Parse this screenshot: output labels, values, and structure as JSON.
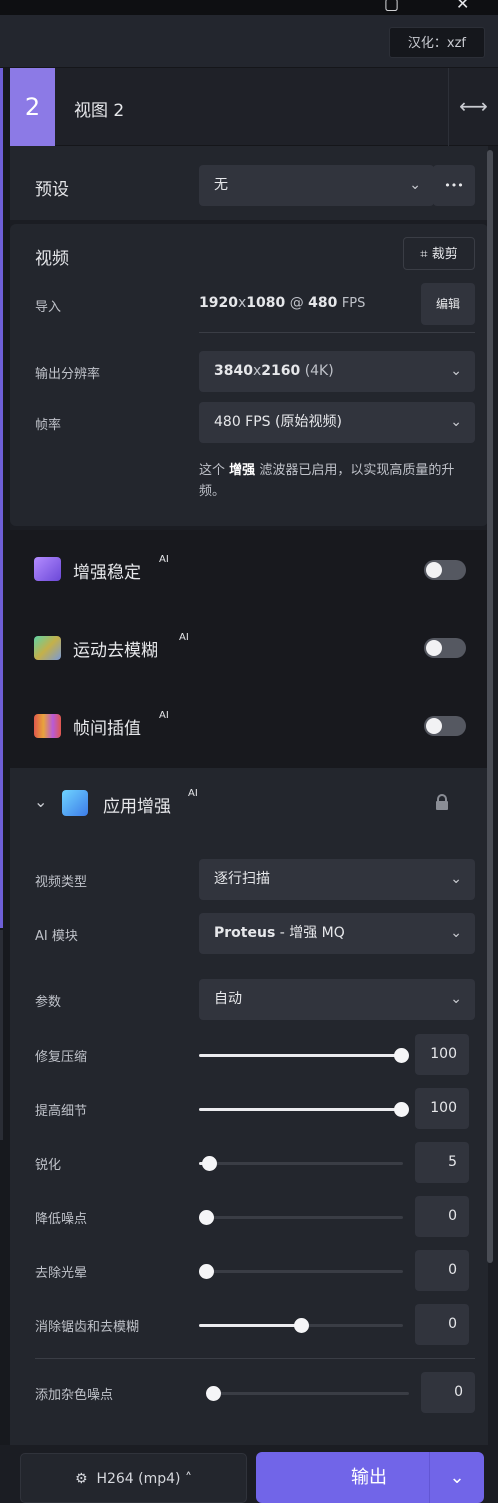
{
  "titlebar": {
    "credit": "汉化：xzf"
  },
  "view": {
    "number": "2",
    "name": "视图 2"
  },
  "preset": {
    "label": "预设",
    "value": "无",
    "more": "•••"
  },
  "video": {
    "title": "视频",
    "crop_label": "裁剪",
    "import_label": "导入",
    "import_width": "1920",
    "import_x": "x",
    "import_height": "1080",
    "import_at": "@",
    "import_fps": "480",
    "import_fps_unit": "FPS",
    "edit_label": "编辑",
    "resolution_label": "输出分辨率",
    "resolution_w": "3840",
    "resolution_x": "x",
    "resolution_h": "2160",
    "resolution_tag": "(4K)",
    "framerate_label": "帧率",
    "framerate_value": "480 FPS (原始视频)",
    "note_prefix": "这个",
    "note_bold": "增强",
    "note_suffix": "滤波器已启用，以实现高质量的升频。"
  },
  "toggles": [
    {
      "label": "增强稳定",
      "ai": "AI",
      "on": false
    },
    {
      "label": "运动去模糊",
      "ai": "AI",
      "on": false
    },
    {
      "label": "帧间插值",
      "ai": "AI",
      "on": false
    }
  ],
  "enhance": {
    "title": "应用增强",
    "ai": "AI",
    "video_type_label": "视频类型",
    "video_type_value": "逐行扫描",
    "model_label": "AI 模块",
    "model_name": "Proteus",
    "model_sep": " - ",
    "model_variant": "增强 MQ",
    "params_label": "参数",
    "params_value": "自动",
    "sliders": [
      {
        "label": "修复压缩",
        "value": "100",
        "level": 1.0
      },
      {
        "label": "提高细节",
        "value": "100",
        "level": 1.0
      },
      {
        "label": "锐化",
        "value": "5",
        "level": 0.05
      },
      {
        "label": "降低噪点",
        "value": "0",
        "level": 0.0
      },
      {
        "label": "去除光晕",
        "value": "0",
        "level": 0.0
      },
      {
        "label": "消除锯齿和去模糊",
        "value": "0",
        "level": 0.5
      }
    ],
    "grain": {
      "label": "添加杂色噪点",
      "value": "0",
      "level": 0.0
    }
  },
  "bottom": {
    "codec": "H264 (mp4)",
    "export": "输出"
  },
  "colors": {
    "accent": "#8c7ae6",
    "export": "#7165e8"
  }
}
